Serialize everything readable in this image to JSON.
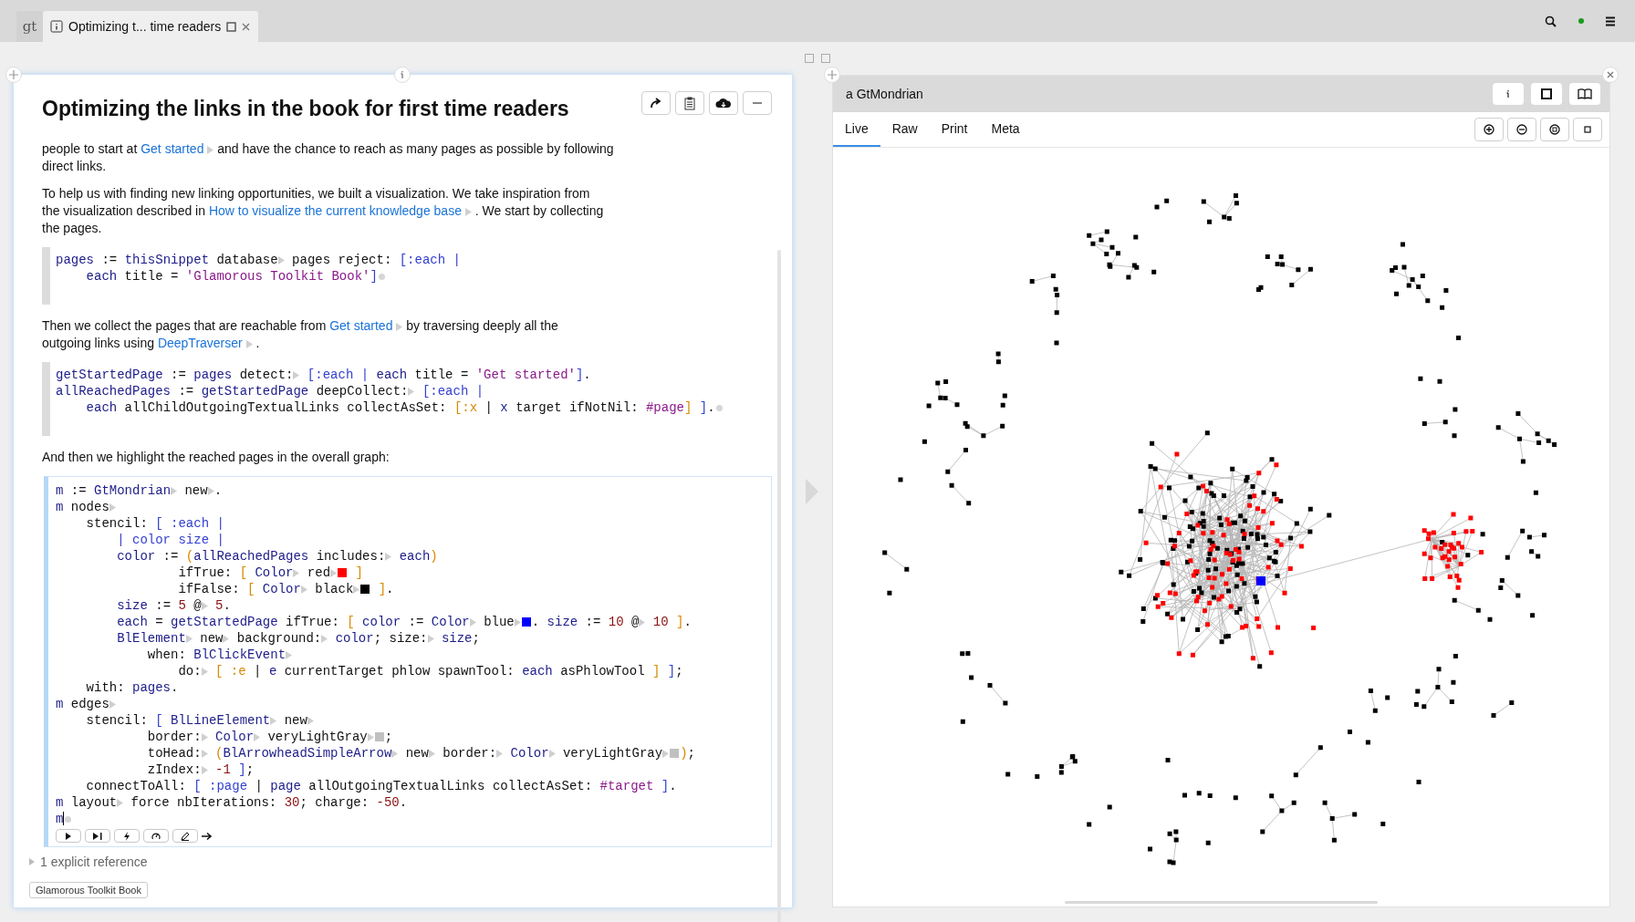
{
  "tab_bar": {
    "logo": "gt",
    "tab_title": "Optimizing t... time readers"
  },
  "page": {
    "title": "Optimizing the links in the book for first time readers",
    "blocks": [
      {
        "kind": "paragraph",
        "parts": [
          {
            "kind": "text",
            "text": "people to start at "
          },
          {
            "kind": "link",
            "text": "Get started"
          },
          {
            "kind": "text",
            "text": " and have the chance to reach as many pages as possible by following"
          },
          {
            "kind": "break"
          },
          {
            "kind": "text",
            "text": "direct links."
          }
        ]
      },
      {
        "kind": "paragraph",
        "parts": [
          {
            "kind": "text",
            "text": "To help us with finding new linking opportunities, we built a visualization. We take inspiration from"
          },
          {
            "kind": "break"
          },
          {
            "kind": "text",
            "text": "the visualization described in "
          },
          {
            "kind": "link",
            "text": "How to visualize the current knowledge base"
          },
          {
            "kind": "text",
            "text": " . We start by collecting"
          },
          {
            "kind": "break"
          },
          {
            "kind": "text",
            "text": "the pages."
          }
        ]
      },
      {
        "kind": "snippet",
        "lines": [
          [
            {
              "kind": "name",
              "text": "pages"
            },
            {
              "kind": "plain",
              "text": " := "
            },
            {
              "kind": "name",
              "text": "thisSnippet"
            },
            {
              "kind": "plain",
              "text": " database"
            },
            {
              "kind": "expander"
            },
            {
              "kind": "plain",
              "text": " pages reject: "
            },
            {
              "kind": "bracket",
              "text": "[:each |"
            }
          ],
          [
            {
              "kind": "name",
              "text": "    each"
            },
            {
              "kind": "plain",
              "text": " title = "
            },
            {
              "kind": "string",
              "text": "'Glamorous Toolkit Book'"
            },
            {
              "kind": "bracket",
              "text": "]"
            },
            {
              "kind": "end"
            }
          ]
        ]
      },
      {
        "kind": "paragraph",
        "parts": [
          {
            "kind": "text",
            "text": "Then we collect the pages that are reachable from "
          },
          {
            "kind": "link",
            "text": "Get started"
          },
          {
            "kind": "text",
            "text": " by traversing deeply all the"
          },
          {
            "kind": "break"
          },
          {
            "kind": "text",
            "text": "outgoing links using "
          },
          {
            "kind": "link",
            "text": "DeepTraverser"
          },
          {
            "kind": "text",
            "text": " ."
          }
        ]
      },
      {
        "kind": "snippet",
        "lines": [
          [
            {
              "kind": "name",
              "text": "getStartedPage"
            },
            {
              "kind": "plain",
              "text": " := "
            },
            {
              "kind": "name",
              "text": "pages"
            },
            {
              "kind": "plain",
              "text": " detect:"
            },
            {
              "kind": "expander"
            },
            {
              "kind": "bracket",
              "text": " [:each | "
            },
            {
              "kind": "name",
              "text": "each"
            },
            {
              "kind": "plain",
              "text": " title = "
            },
            {
              "kind": "string",
              "text": "'Get started'"
            },
            {
              "kind": "bracket",
              "text": "]"
            },
            {
              "kind": "plain",
              "text": "."
            }
          ],
          [
            {
              "kind": "name",
              "text": "allReachedPages"
            },
            {
              "kind": "plain",
              "text": " := "
            },
            {
              "kind": "name",
              "text": "getStartedPage"
            },
            {
              "kind": "plain",
              "text": " deepCollect:"
            },
            {
              "kind": "expander"
            },
            {
              "kind": "bracket",
              "text": " [:each |"
            }
          ],
          [
            {
              "kind": "name",
              "text": "    each"
            },
            {
              "kind": "plain",
              "text": " allChildOutgoingTextualLinks collectAsSet: "
            },
            {
              "kind": "paren",
              "text": "[:x"
            },
            {
              "kind": "plain",
              "text": " | "
            },
            {
              "kind": "name",
              "text": "x"
            },
            {
              "kind": "plain",
              "text": " target ifNotNil: "
            },
            {
              "kind": "string",
              "text": "#page"
            },
            {
              "kind": "paren",
              "text": "]"
            },
            {
              "kind": "bracket",
              "text": " ]"
            },
            {
              "kind": "plain",
              "text": "."
            },
            {
              "kind": "end"
            }
          ]
        ]
      },
      {
        "kind": "paragraph",
        "parts": [
          {
            "kind": "text",
            "text": "And then we highlight the reached pages in the overall graph:"
          }
        ]
      },
      {
        "kind": "editor",
        "lines": [
          [
            {
              "kind": "name",
              "text": "m"
            },
            {
              "kind": "plain",
              "text": " := "
            },
            {
              "kind": "name",
              "text": "GtMondrian"
            },
            {
              "kind": "expander"
            },
            {
              "kind": "plain",
              "text": " new"
            },
            {
              "kind": "expander"
            },
            {
              "kind": "plain",
              "text": "."
            }
          ],
          [
            {
              "kind": "name",
              "text": "m"
            },
            {
              "kind": "plain",
              "text": " nodes"
            },
            {
              "kind": "expander"
            }
          ],
          [
            {
              "kind": "plain",
              "text": "    stencil: "
            },
            {
              "kind": "bracket",
              "text": "[ :each |"
            }
          ],
          [
            {
              "kind": "bracket",
              "text": "        | color size |"
            }
          ],
          [
            {
              "kind": "name",
              "text": "        color"
            },
            {
              "kind": "plain",
              "text": " := "
            },
            {
              "kind": "paren",
              "text": "("
            },
            {
              "kind": "name",
              "text": "allReachedPages"
            },
            {
              "kind": "plain",
              "text": " includes:"
            },
            {
              "kind": "expander"
            },
            {
              "kind": "name",
              "text": " each"
            },
            {
              "kind": "paren",
              "text": ")"
            }
          ],
          [
            {
              "kind": "plain",
              "text": "                ifTrue: "
            },
            {
              "kind": "paren",
              "text": "[ "
            },
            {
              "kind": "name",
              "text": "Color"
            },
            {
              "kind": "expander"
            },
            {
              "kind": "plain",
              "text": " red"
            },
            {
              "kind": "expander"
            },
            {
              "kind": "swatch",
              "color": "#ff0000"
            },
            {
              "kind": "paren",
              "text": " ]"
            }
          ],
          [
            {
              "kind": "plain",
              "text": "                ifFalse: "
            },
            {
              "kind": "paren",
              "text": "[ "
            },
            {
              "kind": "name",
              "text": "Color"
            },
            {
              "kind": "expander"
            },
            {
              "kind": "plain",
              "text": " black"
            },
            {
              "kind": "expander"
            },
            {
              "kind": "swatch",
              "color": "#000000"
            },
            {
              "kind": "paren",
              "text": " ]"
            },
            {
              "kind": "plain",
              "text": "."
            }
          ],
          [
            {
              "kind": "name",
              "text": "        size"
            },
            {
              "kind": "plain",
              "text": " := "
            },
            {
              "kind": "number",
              "text": "5"
            },
            {
              "kind": "plain",
              "text": " @"
            },
            {
              "kind": "expander"
            },
            {
              "kind": "number",
              "text": " 5"
            },
            {
              "kind": "plain",
              "text": "."
            }
          ],
          [
            {
              "kind": "name",
              "text": "        each"
            },
            {
              "kind": "plain",
              "text": " = "
            },
            {
              "kind": "name",
              "text": "getStartedPage"
            },
            {
              "kind": "plain",
              "text": " ifTrue: "
            },
            {
              "kind": "paren",
              "text": "[ "
            },
            {
              "kind": "name",
              "text": "color"
            },
            {
              "kind": "plain",
              "text": " := "
            },
            {
              "kind": "name",
              "text": "Color"
            },
            {
              "kind": "expander"
            },
            {
              "kind": "plain",
              "text": " blue"
            },
            {
              "kind": "expander"
            },
            {
              "kind": "swatch",
              "color": "#0000ff"
            },
            {
              "kind": "plain",
              "text": ". "
            },
            {
              "kind": "name",
              "text": "size"
            },
            {
              "kind": "plain",
              "text": " := "
            },
            {
              "kind": "number",
              "text": "10"
            },
            {
              "kind": "plain",
              "text": " @"
            },
            {
              "kind": "expander"
            },
            {
              "kind": "number",
              "text": " 10"
            },
            {
              "kind": "paren",
              "text": " ]"
            },
            {
              "kind": "plain",
              "text": "."
            }
          ],
          [
            {
              "kind": "name",
              "text": "        BlElement"
            },
            {
              "kind": "expander"
            },
            {
              "kind": "plain",
              "text": " new"
            },
            {
              "kind": "expander"
            },
            {
              "kind": "plain",
              "text": " background:"
            },
            {
              "kind": "expander"
            },
            {
              "kind": "name",
              "text": " color"
            },
            {
              "kind": "plain",
              "text": "; size:"
            },
            {
              "kind": "expander"
            },
            {
              "kind": "name",
              "text": " size"
            },
            {
              "kind": "plain",
              "text": ";"
            }
          ],
          [
            {
              "kind": "plain",
              "text": "            when: "
            },
            {
              "kind": "name",
              "text": "BlClickEvent"
            },
            {
              "kind": "expander"
            }
          ],
          [
            {
              "kind": "plain",
              "text": "                do:"
            },
            {
              "kind": "expander"
            },
            {
              "kind": "paren",
              "text": " [ :e"
            },
            {
              "kind": "plain",
              "text": " | "
            },
            {
              "kind": "name",
              "text": "e"
            },
            {
              "kind": "plain",
              "text": " currentTarget phlow spawnTool: "
            },
            {
              "kind": "name",
              "text": "each"
            },
            {
              "kind": "plain",
              "text": " asPhlowTool "
            },
            {
              "kind": "paren",
              "text": "]"
            },
            {
              "kind": "bracket",
              "text": " ]"
            },
            {
              "kind": "plain",
              "text": ";"
            }
          ],
          [
            {
              "kind": "plain",
              "text": "    with: "
            },
            {
              "kind": "name",
              "text": "pages"
            },
            {
              "kind": "plain",
              "text": "."
            }
          ],
          [
            {
              "kind": "name",
              "text": "m"
            },
            {
              "kind": "plain",
              "text": " edges"
            },
            {
              "kind": "expander"
            }
          ],
          [
            {
              "kind": "plain",
              "text": "    stencil: "
            },
            {
              "kind": "bracket",
              "text": "[ "
            },
            {
              "kind": "name",
              "text": "BlLineElement"
            },
            {
              "kind": "expander"
            },
            {
              "kind": "plain",
              "text": " new"
            },
            {
              "kind": "expander"
            }
          ],
          [
            {
              "kind": "plain",
              "text": "            border:"
            },
            {
              "kind": "expander"
            },
            {
              "kind": "name",
              "text": " Color"
            },
            {
              "kind": "expander"
            },
            {
              "kind": "plain",
              "text": " veryLightGray"
            },
            {
              "kind": "expander"
            },
            {
              "kind": "swatch",
              "color": "#c0c0c0"
            },
            {
              "kind": "plain",
              "text": ";"
            }
          ],
          [
            {
              "kind": "plain",
              "text": "            toHead:"
            },
            {
              "kind": "expander"
            },
            {
              "kind": "paren",
              "text": " ("
            },
            {
              "kind": "name",
              "text": "BlArrowheadSimpleArrow"
            },
            {
              "kind": "expander"
            },
            {
              "kind": "plain",
              "text": " new"
            },
            {
              "kind": "expander"
            },
            {
              "kind": "plain",
              "text": " border:"
            },
            {
              "kind": "expander"
            },
            {
              "kind": "name",
              "text": " Color"
            },
            {
              "kind": "expander"
            },
            {
              "kind": "plain",
              "text": " veryLightGray"
            },
            {
              "kind": "expander"
            },
            {
              "kind": "swatch",
              "color": "#c0c0c0"
            },
            {
              "kind": "paren",
              "text": ")"
            },
            {
              "kind": "plain",
              "text": ";"
            }
          ],
          [
            {
              "kind": "plain",
              "text": "            zIndex:"
            },
            {
              "kind": "expander"
            },
            {
              "kind": "number",
              "text": " -1"
            },
            {
              "kind": "bracket",
              "text": " ]"
            },
            {
              "kind": "plain",
              "text": ";"
            }
          ],
          [
            {
              "kind": "plain",
              "text": "    connectToAll: "
            },
            {
              "kind": "bracket",
              "text": "[ :page"
            },
            {
              "kind": "plain",
              "text": " | "
            },
            {
              "kind": "name",
              "text": "page"
            },
            {
              "kind": "plain",
              "text": " allOutgoingTextualLinks collectAsSet: "
            },
            {
              "kind": "string",
              "text": "#target"
            },
            {
              "kind": "bracket",
              "text": " ]"
            },
            {
              "kind": "plain",
              "text": "."
            }
          ],
          [
            {
              "kind": "name",
              "text": "m"
            },
            {
              "kind": "plain",
              "text": " layout"
            },
            {
              "kind": "expander"
            },
            {
              "kind": "plain",
              "text": " force nbIterations: "
            },
            {
              "kind": "number",
              "text": "30"
            },
            {
              "kind": "plain",
              "text": "; charge: "
            },
            {
              "kind": "number",
              "text": "-50"
            },
            {
              "kind": "plain",
              "text": "."
            }
          ],
          [
            {
              "kind": "name",
              "text": "m"
            },
            {
              "kind": "cursor"
            },
            {
              "kind": "end"
            }
          ]
        ]
      }
    ],
    "reference": "1 explicit reference",
    "tag": "Glamorous Toolkit Book"
  },
  "inspector": {
    "title": "a GtMondrian",
    "tabs": [
      {
        "label": "Live",
        "selected": true
      },
      {
        "label": "Raw",
        "selected": false
      },
      {
        "label": "Print",
        "selected": false
      },
      {
        "label": "Meta",
        "selected": false
      }
    ]
  }
}
